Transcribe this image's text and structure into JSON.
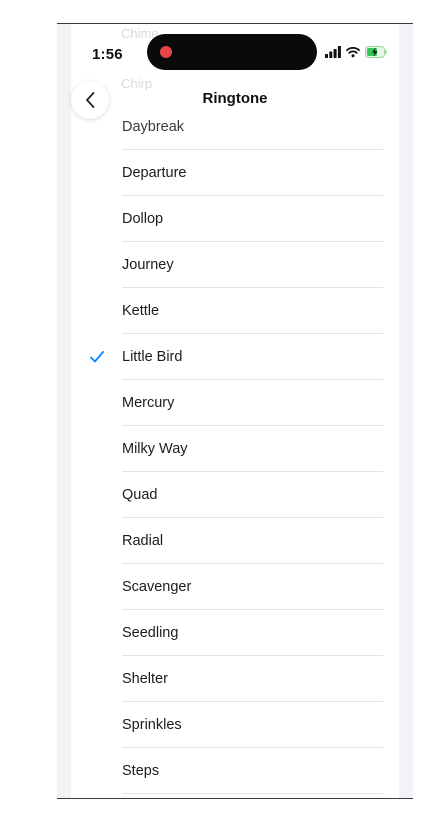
{
  "status_bar": {
    "time": "1:56",
    "recording_dot_color": "#e64545",
    "icons": [
      "signal-icon",
      "wifi-icon",
      "battery-charging-icon"
    ]
  },
  "ghost_items": [
    "Chime",
    "Chirp"
  ],
  "nav": {
    "title": "Ringtone",
    "back_icon": "chevron-left-icon"
  },
  "accent_color": "#0a84ff",
  "selected_ringtone": "Little Bird",
  "ringtones": [
    "Daybreak",
    "Departure",
    "Dollop",
    "Journey",
    "Kettle",
    "Little Bird",
    "Mercury",
    "Milky Way",
    "Quad",
    "Radial",
    "Scavenger",
    "Seedling",
    "Shelter",
    "Sprinkles",
    "Steps"
  ]
}
